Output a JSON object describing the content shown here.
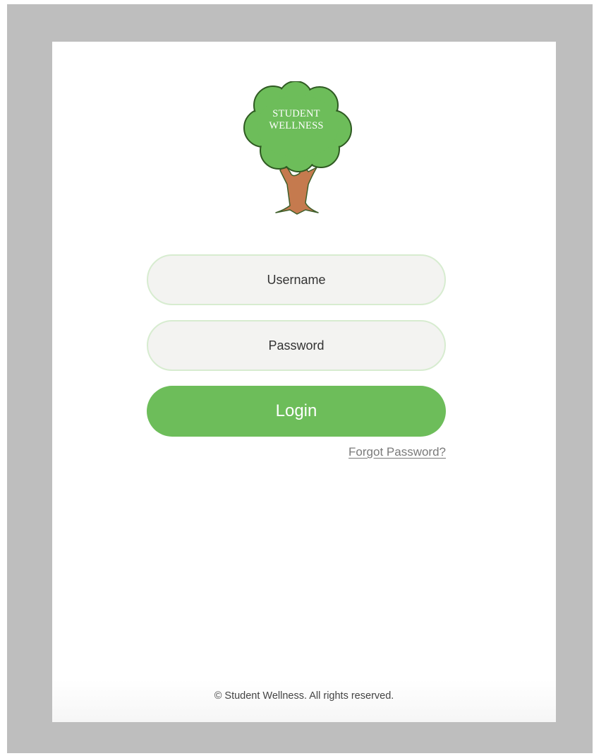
{
  "logo": {
    "line1": "STUDENT",
    "line2": "WELLNESS",
    "icon": "tree-logo-icon",
    "canopy_color": "#6dbd5a",
    "trunk_color": "#c57a4e"
  },
  "login_form": {
    "username_placeholder": "Username",
    "password_placeholder": "Password",
    "login_label": "Login",
    "forgot_password_label": "Forgot Password?"
  },
  "footer": {
    "copyright": "© Student Wellness. All rights reserved."
  },
  "colors": {
    "accent": "#6dbd5a",
    "field_background": "#f3f3f1",
    "field_border": "#d7ecd0",
    "backdrop": "#bebebe"
  }
}
